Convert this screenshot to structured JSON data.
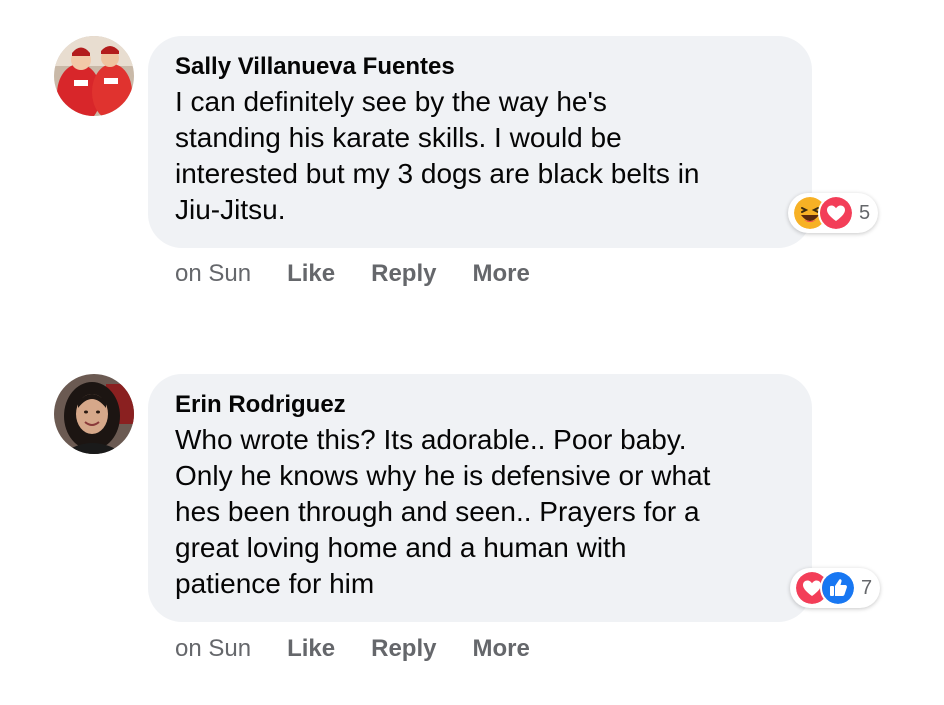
{
  "comments": [
    {
      "author": "Sally Villanueva Fuentes",
      "text": "I can definitely see by the way he's\nstanding his karate skills. I would be\ninterested but my 3 dogs are black belts in\nJiu-Jitsu.",
      "reactions": {
        "icons": [
          "haha-icon",
          "love-icon"
        ],
        "count": "5"
      },
      "time": "on Sun",
      "actions": {
        "like": "Like",
        "reply": "Reply",
        "more": "More"
      }
    },
    {
      "author": "Erin Rodriguez",
      "text": "Who wrote this? Its adorable.. Poor baby.\nOnly he knows why he is defensive or what\nhes been through and seen.. Prayers for a\ngreat loving home and a human with\npatience for him",
      "reactions": {
        "icons": [
          "love-icon",
          "like-icon"
        ],
        "count": "7"
      },
      "time": "on Sun",
      "actions": {
        "like": "Like",
        "reply": "Reply",
        "more": "More"
      }
    }
  ],
  "colors": {
    "bubble": "#f0f2f5",
    "text": "#050505",
    "secondary": "#65676b",
    "love": "#f33e58",
    "like": "#1877f2",
    "haha": "#f7b125"
  }
}
